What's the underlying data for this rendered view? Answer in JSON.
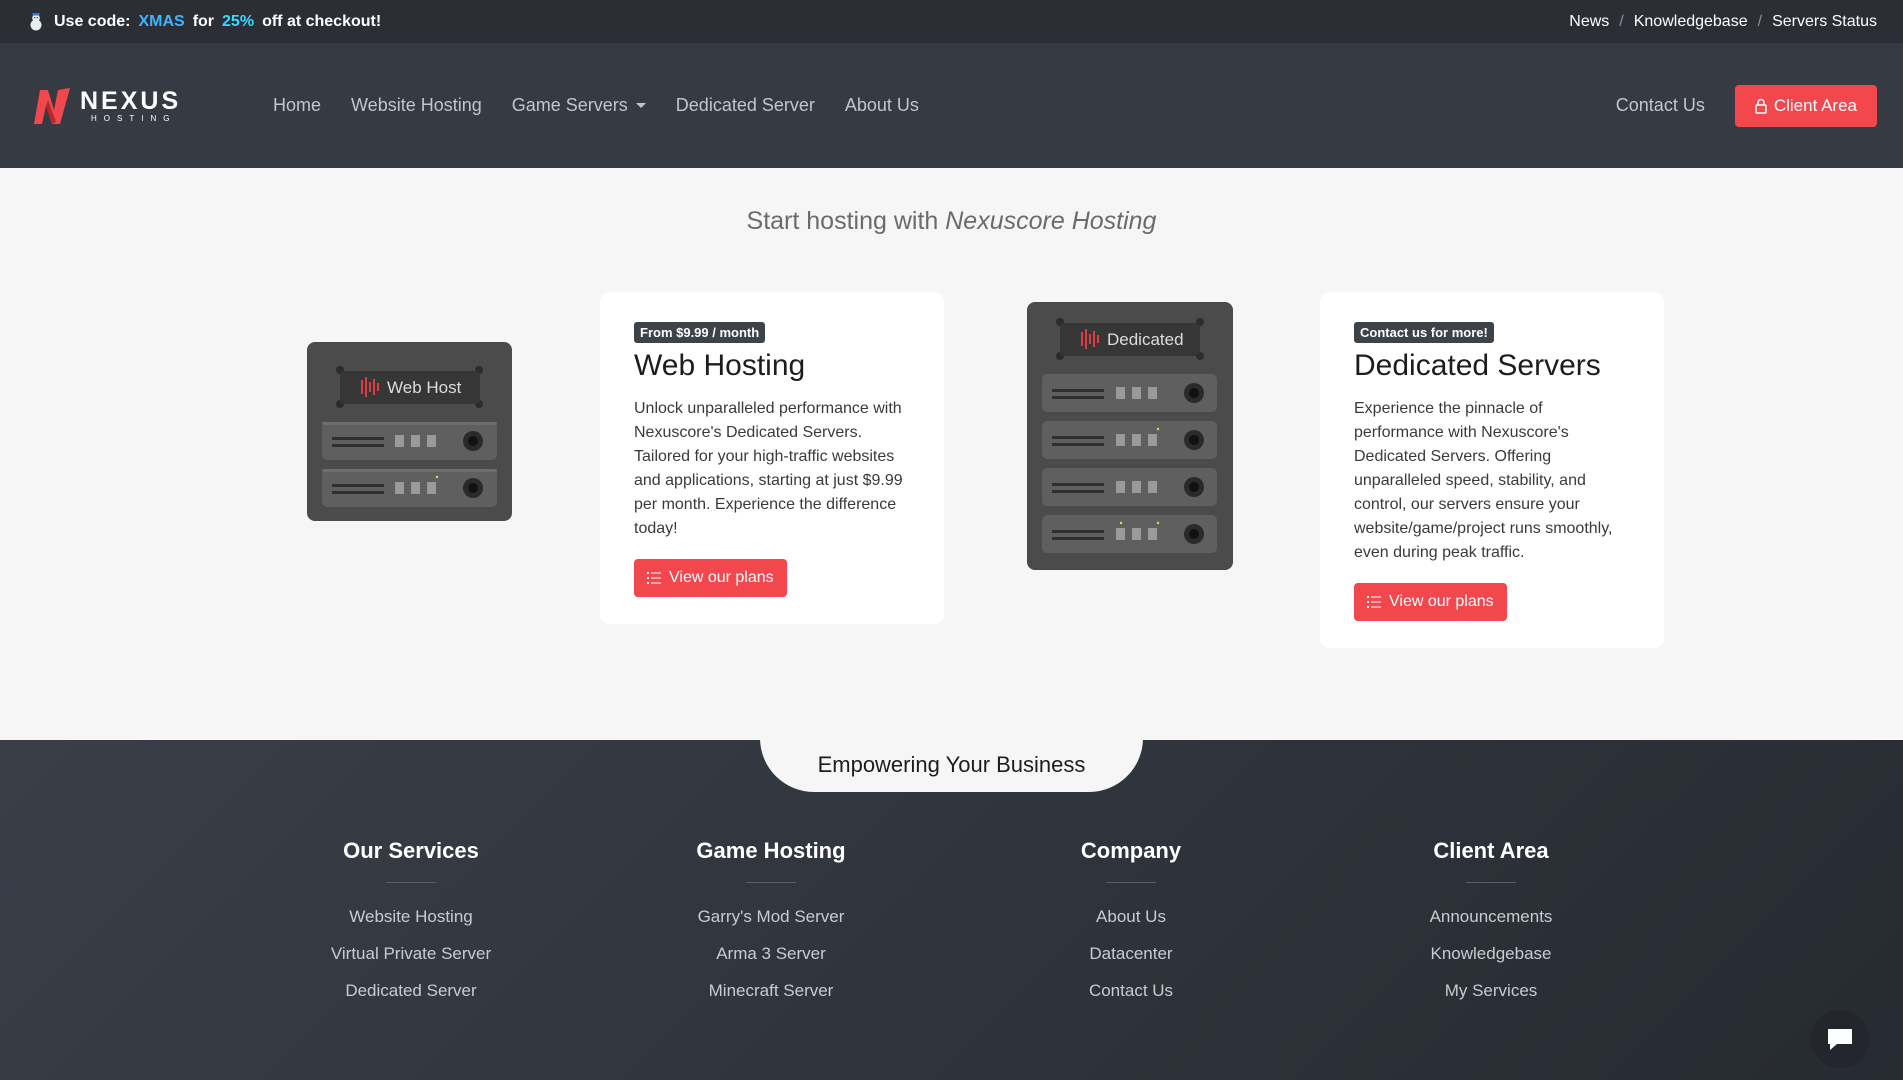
{
  "promo": {
    "prefix": "Use code:",
    "code": "XMAS",
    "for": "for",
    "discount": "25%",
    "suffix": "off at checkout!",
    "links": [
      "News",
      "Knowledgebase",
      "Servers Status"
    ],
    "separator": "/"
  },
  "header": {
    "logo_main": "NEXUS",
    "logo_sub": "HOSTING",
    "nav": [
      "Home",
      "Website Hosting",
      "Game Servers",
      "Dedicated Server",
      "About Us"
    ],
    "contact": "Contact Us",
    "client_area": "Client Area"
  },
  "main": {
    "title_prefix": "Start hosting with",
    "title_brand": "Nexuscore Hosting",
    "products": [
      {
        "badge": "From $9.99 / month",
        "title": "Web Hosting",
        "description": "Unlock unparalleled performance with Nexuscore's Dedicated Servers. Tailored for your high-traffic websites and applications, starting at just $9.99 per month. Experience the difference today!",
        "button": "View our plans",
        "image_label": "Web Host"
      },
      {
        "badge": "Contact us for more!",
        "title": "Dedicated Servers",
        "description": "Experience the pinnacle of performance with Nexuscore's Dedicated Servers. Offering unparalleled speed, stability, and control, our servers ensure your website/game/project runs smoothly, even during peak traffic.",
        "button": "View our plans",
        "image_label": "Dedicated"
      }
    ]
  },
  "footer": {
    "tagline": "Empowering Your Business",
    "columns": [
      {
        "title": "Our Services",
        "links": [
          "Website Hosting",
          "Virtual Private Server",
          "Dedicated Server"
        ]
      },
      {
        "title": "Game Hosting",
        "links": [
          "Garry's Mod Server",
          "Arma 3 Server",
          "Minecraft Server"
        ]
      },
      {
        "title": "Company",
        "links": [
          "About Us",
          "Datacenter",
          "Contact Us"
        ]
      },
      {
        "title": "Client Area",
        "links": [
          "Announcements",
          "Knowledgebase",
          "My Services"
        ]
      }
    ]
  },
  "colors": {
    "accent": "#f2474d",
    "promo_code": "#3fb4ff",
    "dark": "#363a43"
  },
  "icons": [
    "snowman-icon",
    "caret-down-icon",
    "lock-icon",
    "list-icon",
    "chat-icon"
  ]
}
